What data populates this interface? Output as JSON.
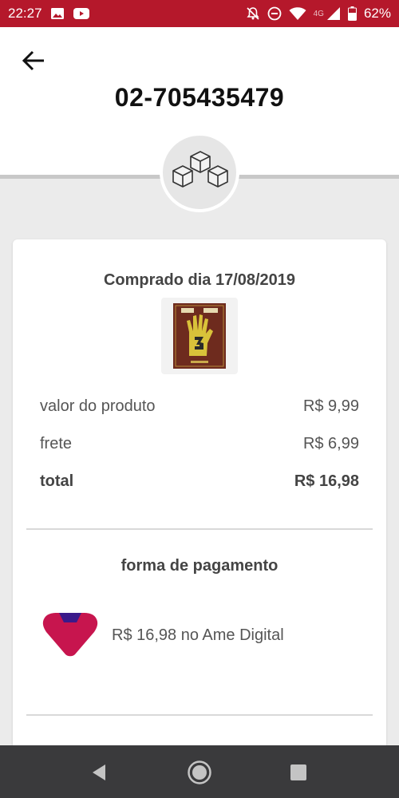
{
  "status_bar": {
    "time": "22:27",
    "network": "4G",
    "battery": "62%",
    "left_icons": [
      "image-icon",
      "youtube-icon"
    ],
    "right_icons": [
      "notifications-off-icon",
      "do-not-disturb-icon",
      "wifi-icon",
      "signal-icon",
      "battery-icon"
    ],
    "background_color": "#b5182b"
  },
  "header": {
    "order_number": "02-705435479"
  },
  "order": {
    "purchase_date": "Comprado dia 17/08/2019",
    "rows": [
      {
        "label": "valor do produto",
        "value": "R$ 9,99"
      },
      {
        "label": "frete",
        "value": "R$ 6,99"
      },
      {
        "label": "total",
        "value": "R$ 16,98"
      }
    ]
  },
  "payment": {
    "title": "forma de pagamento",
    "description": "R$ 16,98 no Ame Digital",
    "logo_colors": {
      "primary": "#c7154e",
      "accent": "#3a1a8a"
    }
  },
  "nav_bar": {
    "buttons": [
      "back-triangle-icon",
      "home-circle-icon",
      "recents-square-icon"
    ]
  }
}
